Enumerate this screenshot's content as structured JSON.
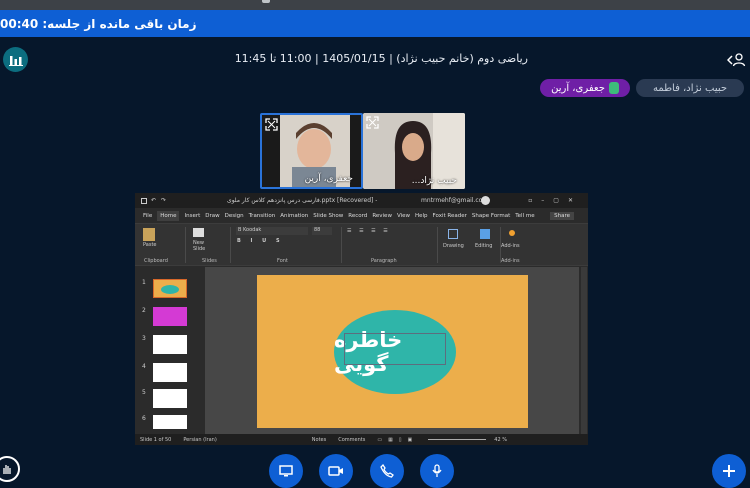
{
  "timer": {
    "text": "زمان باقی مانده از جلسه: 00:40"
  },
  "meeting": {
    "title": "ریاضی دوم (خانم حبیب نژاد) | 1405/01/15 | 11:00 تا 11:45"
  },
  "participants": [
    {
      "name": "حبیب نژاد، فاطمه",
      "talking": false
    },
    {
      "name": "جعفری، آرین",
      "talking": true
    }
  ],
  "videos": [
    {
      "name": "جعفری، آرین"
    },
    {
      "name": "حبیب نژاد..."
    }
  ],
  "powerpoint": {
    "title": "فارسی درس پانزدهم کلاس کار ملوی.pptx [Recovered] - PowerPoint",
    "account": "mntrmehf@gmail.com",
    "menu": [
      "File",
      "Home",
      "Insert",
      "Draw",
      "Design",
      "Transition",
      "Animation",
      "Slide Show",
      "Record",
      "Review",
      "View",
      "Help",
      "Foxit Reader",
      "Shape Format"
    ],
    "tellme": "Tell me",
    "share": "Share",
    "font_name": "B Koodak",
    "font_size": "88",
    "groups": [
      "Clipboard",
      "Slides",
      "Font",
      "Paragraph",
      "Add-ins"
    ],
    "big_buttons": [
      "Paste",
      "New Slide",
      "Drawing",
      "Editing",
      "Add-ins"
    ],
    "slide_text": "خاطره گویی",
    "status": {
      "slide": "Slide 1 of 50",
      "lang": "Persian (Iran)",
      "notes": "Notes",
      "comments": "Comments",
      "zoom": "42 %"
    },
    "thumbs": [
      "1",
      "2",
      "3",
      "4",
      "5",
      "6"
    ]
  },
  "colors": {
    "timer_bg": "#0e5fd4",
    "slide_bg": "#ecae4b",
    "oval": "#2fb5a9",
    "talking_chip": "#6f1fa6"
  }
}
